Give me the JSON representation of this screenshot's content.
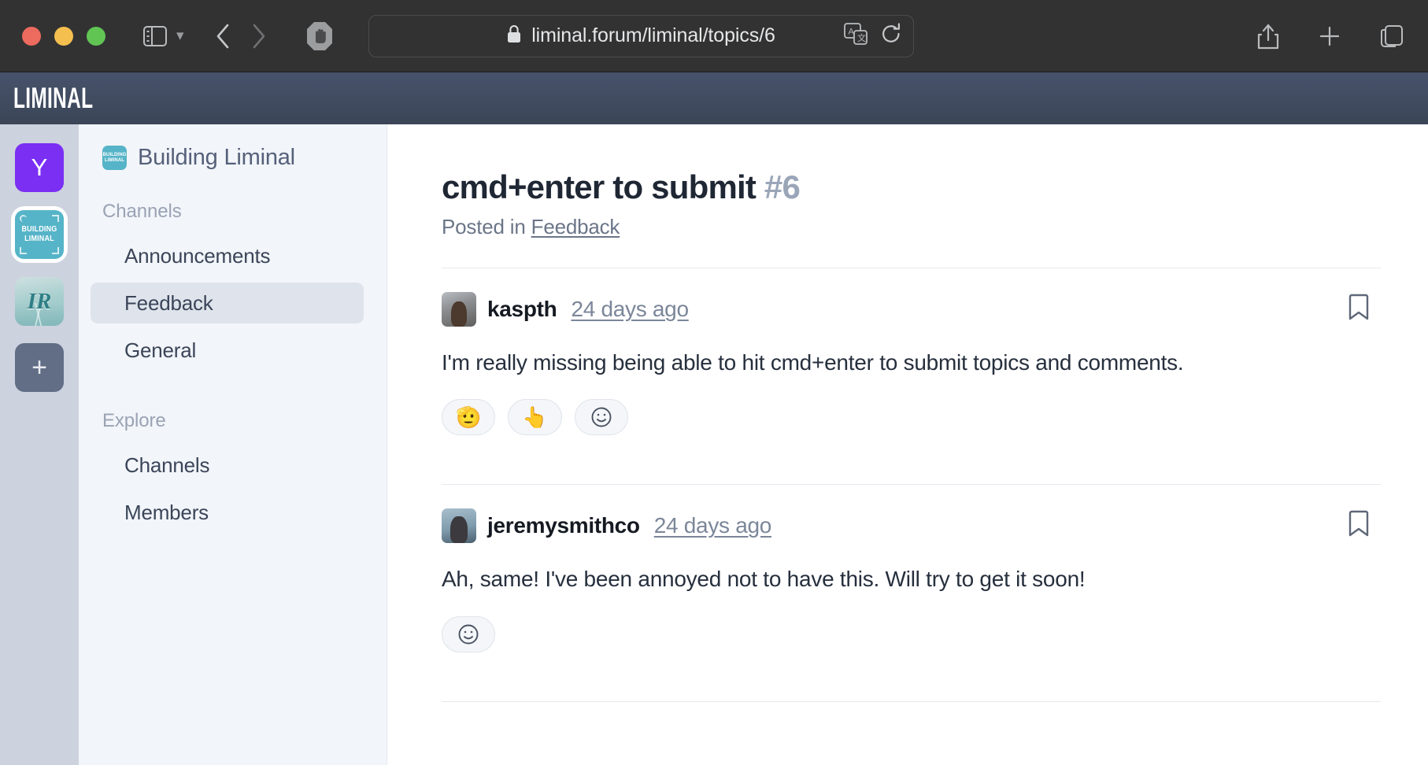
{
  "browser": {
    "url": "liminal.forum/liminal/topics/6",
    "lock_icon": "lock-icon",
    "reload_icon": "reload-icon",
    "translate_icon": "translate-icon",
    "sidebar_icon": "sidebar-toggle-icon",
    "back_icon": "back-arrow-icon",
    "forward_icon": "forward-arrow-icon",
    "shield_icon": "ad-block-shield-icon",
    "reader_icon": "reader-view-icon",
    "share_icon": "share-icon",
    "new_tab_icon": "plus-icon",
    "tab_overview_icon": "tab-overview-icon"
  },
  "app_header": {
    "brand": "LIMINAL"
  },
  "rail": {
    "items": [
      {
        "name": "workspace-y",
        "label": "Y",
        "icon": "workspace-avatar-y",
        "selected": false
      },
      {
        "name": "workspace-building-liminal",
        "label": "BUILDING LIMINAL",
        "icon": "workspace-avatar-bl",
        "selected": true
      },
      {
        "name": "workspace-ir",
        "label": "IR",
        "icon": "workspace-avatar-ir",
        "selected": false
      }
    ],
    "add_label": "+"
  },
  "sidebar": {
    "workspace": {
      "name": "Building Liminal",
      "avatar_text": "BUILDING LIMINAL"
    },
    "sections": [
      {
        "label": "Channels",
        "items": [
          {
            "label": "Announcements",
            "active": false
          },
          {
            "label": "Feedback",
            "active": true
          },
          {
            "label": "General",
            "active": false
          }
        ]
      },
      {
        "label": "Explore",
        "items": [
          {
            "label": "Channels",
            "active": false
          },
          {
            "label": "Members",
            "active": false
          }
        ]
      }
    ]
  },
  "topic": {
    "title": "cmd+enter to submit",
    "number": "#6",
    "posted_in_prefix": "Posted in",
    "channel": "Feedback",
    "posts": [
      {
        "author": "kaspth",
        "timestamp": "24 days ago",
        "body": "I'm really missing being able to hit cmd+enter to submit topics and comments.",
        "bookmark_icon": "bookmark-icon",
        "reactions": [
          {
            "emoji": "🫡",
            "name": "reaction-saluting-face"
          },
          {
            "emoji": "👆",
            "name": "reaction-point-up"
          }
        ],
        "add_reaction_icon": "☺"
      },
      {
        "author": "jeremysmithco",
        "timestamp": "24 days ago",
        "body": "Ah, same! I've been annoyed not to have this. Will try to get it soon!",
        "bookmark_icon": "bookmark-icon",
        "reactions": [],
        "add_reaction_icon": "☺"
      }
    ]
  },
  "colors": {
    "chrome_bg": "#323233",
    "header_bg": "#3f4a5e",
    "rail_bg": "#ccd2de",
    "sidebar_bg": "#f2f5f9",
    "active_nav_bg": "#dfe4ec",
    "accent_purple": "#7a2ff2",
    "accent_teal": "#56b4c8",
    "text_dark": "#1f2734",
    "text_muted": "#7b8699"
  }
}
